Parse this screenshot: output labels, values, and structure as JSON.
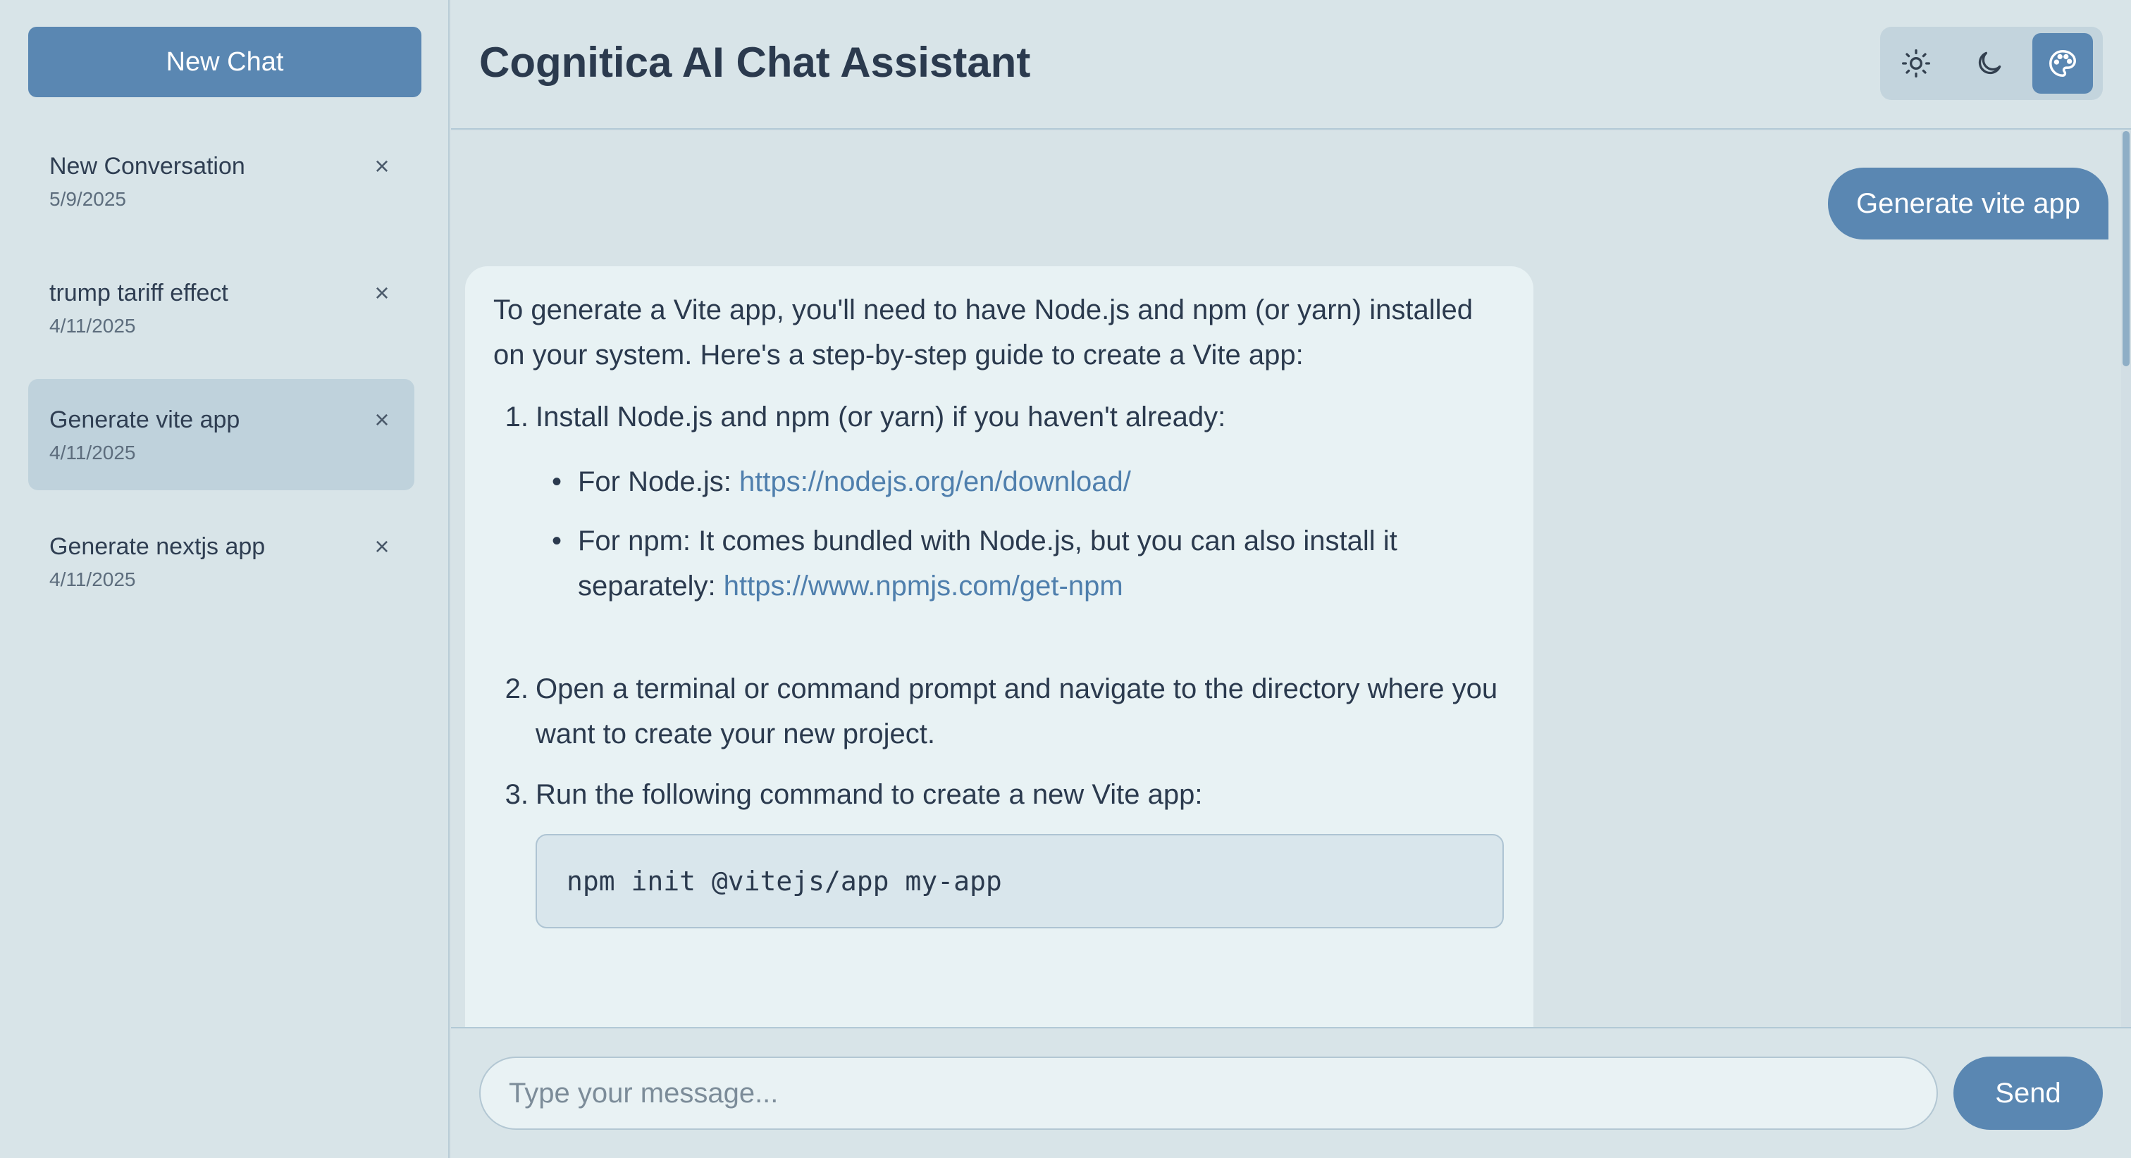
{
  "sidebar": {
    "new_chat_label": "New Chat",
    "conversations": [
      {
        "title": "New Conversation",
        "date": "5/9/2025",
        "close": "×"
      },
      {
        "title": "trump tariff effect",
        "date": "4/11/2025",
        "close": "×"
      },
      {
        "title": "Generate vite app",
        "date": "4/11/2025",
        "close": "×",
        "active": true
      },
      {
        "title": "Generate nextjs app",
        "date": "4/11/2025",
        "close": "×"
      }
    ]
  },
  "header": {
    "title": "Cognitica AI Chat Assistant",
    "theme_buttons": [
      {
        "icon": "sun-icon",
        "active": false
      },
      {
        "icon": "moon-icon",
        "active": false
      },
      {
        "icon": "palette-icon",
        "active": true
      }
    ]
  },
  "chat": {
    "user_message": "Generate vite app",
    "assistant": {
      "intro": "To generate a Vite app, you'll need to have Node.js and npm (or yarn) installed on your system. Here's a step-by-step guide to create a Vite app:",
      "steps": [
        {
          "num": "1.",
          "text": "Install Node.js and npm (or yarn) if you haven't already:",
          "bullets": [
            {
              "prefix": "For Node.js: ",
              "link": "https://nodejs.org/en/download/"
            },
            {
              "prefix": "For npm: It comes bundled with Node.js, but you can also install it separately: ",
              "link": "https://www.npmjs.com/get-npm"
            }
          ]
        },
        {
          "num": "2.",
          "text": "Open a terminal or command prompt and navigate to the directory where you want to create your new project."
        },
        {
          "num": "3.",
          "text": "Run the following command to create a new Vite app:",
          "code": "npm init @vitejs/app my-app"
        }
      ],
      "bullet_symbol": "•"
    }
  },
  "composer": {
    "placeholder": "Type your message...",
    "value": "",
    "send_label": "Send"
  },
  "colors": {
    "accent": "#5a87b2",
    "background": "#d5e1e6",
    "bubble": "#e8f2f4",
    "link": "#4f7fad",
    "active_item": "#bfd2dc"
  }
}
